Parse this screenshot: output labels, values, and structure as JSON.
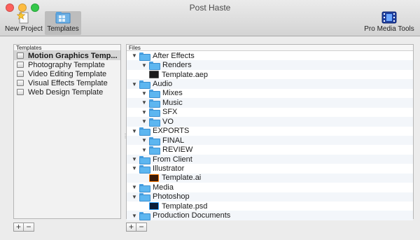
{
  "window": {
    "title": "Post Haste"
  },
  "toolbar": {
    "new_project_label": "New Project",
    "templates_label": "Templates",
    "pro_media_tools_label": "Pro Media Tools"
  },
  "templates_panel": {
    "header": "Templates",
    "items": [
      "Motion Graphics Temp...",
      "Photography Template",
      "Video Editing Template",
      "Visual Effects Template",
      "Web Design Template"
    ],
    "selected_index": 0
  },
  "files_panel": {
    "header": "Files",
    "rows": [
      {
        "name": "After Effects",
        "type": "folder",
        "level": 0,
        "expanded": true
      },
      {
        "name": "Renders",
        "type": "folder",
        "level": 1,
        "expanded": true
      },
      {
        "name": "Template.aep",
        "type": "aep",
        "level": 1
      },
      {
        "name": "Audio",
        "type": "folder",
        "level": 0,
        "expanded": true
      },
      {
        "name": "Mixes",
        "type": "folder",
        "level": 1,
        "expanded": true
      },
      {
        "name": "Music",
        "type": "folder",
        "level": 1,
        "expanded": true
      },
      {
        "name": "SFX",
        "type": "folder",
        "level": 1,
        "expanded": true
      },
      {
        "name": "VO",
        "type": "folder",
        "level": 1,
        "expanded": true
      },
      {
        "name": "EXPORTS",
        "type": "folder",
        "level": 0,
        "expanded": true
      },
      {
        "name": "FINAL",
        "type": "folder",
        "level": 1,
        "expanded": true
      },
      {
        "name": "REVIEW",
        "type": "folder",
        "level": 1,
        "expanded": true
      },
      {
        "name": "From Client",
        "type": "folder",
        "level": 0,
        "expanded": true
      },
      {
        "name": "Illustrator",
        "type": "folder",
        "level": 0,
        "expanded": true
      },
      {
        "name": "Template.ai",
        "type": "ai",
        "level": 1
      },
      {
        "name": "Media",
        "type": "folder",
        "level": 0,
        "expanded": true
      },
      {
        "name": "Photoshop",
        "type": "folder",
        "level": 0,
        "expanded": true
      },
      {
        "name": "Template.psd",
        "type": "psd",
        "level": 1
      },
      {
        "name": "Production Documents",
        "type": "folder",
        "level": 0,
        "expanded": true
      }
    ]
  },
  "buttons": {
    "add": "+",
    "remove": "−"
  },
  "icons": {
    "new_project": "star-document-icon",
    "templates": "templates-folder-icon",
    "pro_media_tools": "film-strip-icon"
  },
  "colors": {
    "folder": "#5db6f0",
    "selection": "#d6d6d6"
  }
}
